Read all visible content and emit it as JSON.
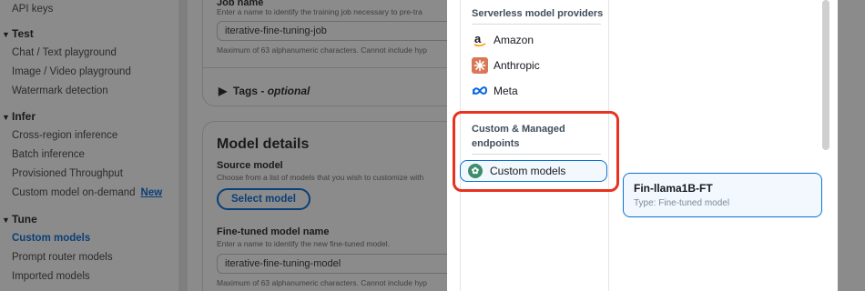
{
  "sidebar": {
    "top_item": "API keys",
    "sections": [
      {
        "title": "Test",
        "items": [
          "Chat / Text playground",
          "Image / Video playground",
          "Watermark detection"
        ]
      },
      {
        "title": "Infer",
        "items": [
          "Cross-region inference",
          "Batch inference",
          "Provisioned Throughput",
          "Custom model on-demand"
        ]
      },
      {
        "title": "Tune",
        "items": [
          "Custom models",
          "Prompt router models",
          "Imported models"
        ]
      }
    ],
    "new_badge": "New",
    "active_item": "Custom models"
  },
  "job_card": {
    "label": "Job name",
    "description": "Enter a name to identify the training job necessary to pre-tra",
    "value": "iterative-fine-tuning-job",
    "constraint": "Maximum of 63 alphanumeric characters. Cannot include hyp",
    "tags_label": "Tags - ",
    "tags_optional": "optional"
  },
  "model_details": {
    "title": "Model details",
    "source_label": "Source model",
    "source_description": "Choose from a list of models that you wish to customize with",
    "select_button": "Select model",
    "fine_tuned_label": "Fine-tuned model name",
    "fine_tuned_description": "Enter a name to identify the new fine-tuned model.",
    "fine_tuned_value": "iterative-fine-tuning-model",
    "constraint": "Maximum of 63 alphanumeric characters. Cannot include hyp"
  },
  "modal": {
    "serverless_heading": "Serverless model providers",
    "providers": [
      {
        "name": "Amazon",
        "icon": "amazon-icon"
      },
      {
        "name": "Anthropic",
        "icon": "anthropic-icon"
      },
      {
        "name": "Meta",
        "icon": "meta-icon"
      }
    ],
    "custom_heading": "Custom & Managed endpoints",
    "custom_button": "Custom models",
    "models": [
      {
        "name": "Fin-llama1B-FT",
        "type": "Type: Fine-tuned model"
      }
    ]
  },
  "colors": {
    "accent": "#0972d3",
    "highlight": "#e8321f",
    "anthropic": "#d97757",
    "meta": "#0668e1"
  }
}
